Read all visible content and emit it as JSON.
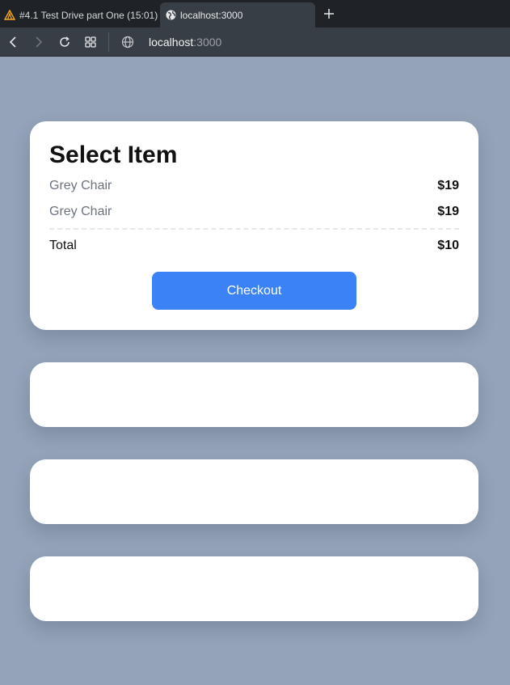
{
  "browser": {
    "tabs": [
      {
        "label": "#4.1 Test Drive part One (15:01)",
        "icon": "warning-triangle-icon",
        "active": false
      },
      {
        "label": "localhost:3000",
        "icon": "globe-icon",
        "active": true
      }
    ],
    "new_tab_icon": "plus-icon",
    "address": {
      "host": "localhost",
      "port": ":3000"
    }
  },
  "card": {
    "title": "Select Item",
    "items": [
      {
        "name": "Grey Chair",
        "price": "$19"
      },
      {
        "name": "Grey Chair",
        "price": "$19"
      }
    ],
    "total_label": "Total",
    "total_value": "$10",
    "checkout_label": "Checkout"
  },
  "colors": {
    "page_bg": "#94a3b8",
    "accent": "#3b82f6",
    "card_bg": "#ffffff",
    "muted_text": "#6b7280"
  }
}
